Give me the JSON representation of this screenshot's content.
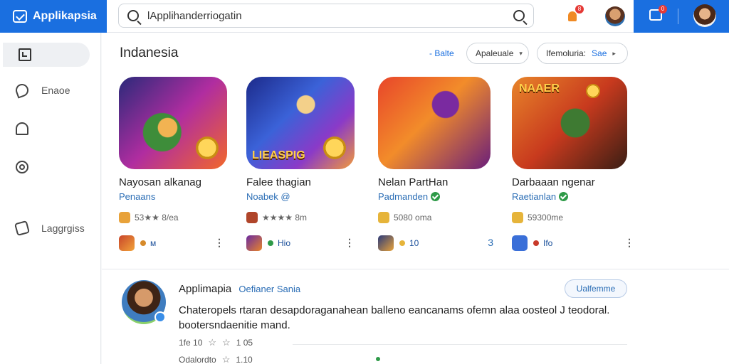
{
  "app": {
    "name": "Applikapsia",
    "accent": "#1a6fe0"
  },
  "search": {
    "value": "lApplihanderriogatin"
  },
  "header": {
    "notification_badge": "8",
    "cart_badge": "0"
  },
  "sidebar": {
    "items": [
      {
        "label": "",
        "icon": "grid-icon",
        "active": true
      },
      {
        "label": "Enaoe",
        "icon": "leaf-icon"
      },
      {
        "label": "",
        "icon": "bell-icon"
      },
      {
        "label": "",
        "icon": "ring-icon"
      },
      {
        "label": "Laggrgiss",
        "icon": "tag-icon"
      }
    ]
  },
  "section": {
    "title": "Indanesia",
    "filter_link": "- Balte",
    "dropdown_label": "Apaleuale",
    "sort_label": "Ifemoluria:",
    "sort_value": "Sae"
  },
  "cards": [
    {
      "title": "Nayosan alkanag",
      "developer": "Penaans",
      "verified": false,
      "rating": "53★★ 8/ea",
      "foot": "ᴍ",
      "foot_val": "Ɛ",
      "menu": "⋮",
      "banner": ""
    },
    {
      "title": "Falee thagian",
      "developer": "Noabek @",
      "verified": false,
      "rating": "★★★★ 8m",
      "foot": "Hio",
      "foot_val": "",
      "menu": "⋮",
      "banner": "LIEASPIG"
    },
    {
      "title": "Nelan PartHan",
      "developer": "Padmanden",
      "verified": true,
      "rating": "5080 oma",
      "foot": "10",
      "foot_val": "3",
      "menu": "",
      "banner": ""
    },
    {
      "title": "Darbaaan ngenar",
      "developer": "Raetianlan",
      "verified": true,
      "rating": "59300me",
      "foot": "Ifo",
      "foot_val": "",
      "menu": "⋮",
      "banner": "NAAER"
    }
  ],
  "review": {
    "name": "Applimapia",
    "verified_label": "Oefianer Sania",
    "follow_label": "Ualfemme",
    "body": "Chateropels rtaran desapdoraganahean balleno eancanams ofemn alaa oosteol J teodoral. bootersndaenitie mand.",
    "stat1_left": "1fe 10",
    "stat1_right": "1 05",
    "stat2_left": "Odalordto",
    "stat2_right": "1.10"
  }
}
